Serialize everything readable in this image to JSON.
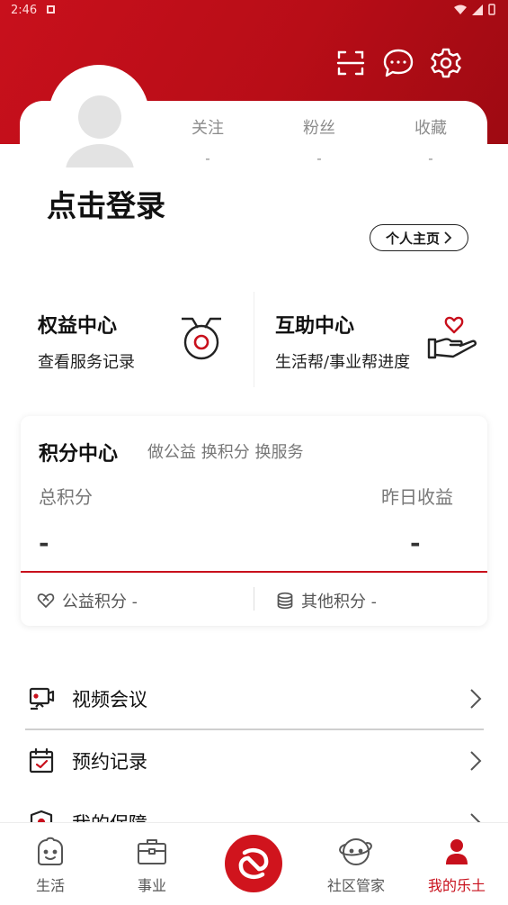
{
  "status_bar": {
    "time": "2:46"
  },
  "profile": {
    "login_text": "点击登录",
    "homepage_button": "个人主页",
    "stats": [
      {
        "label": "关注",
        "value": "-"
      },
      {
        "label": "粉丝",
        "value": "-"
      },
      {
        "label": "收藏",
        "value": "-"
      }
    ]
  },
  "features": [
    {
      "title": "权益中心",
      "subtitle": "查看服务记录",
      "icon": "medal-icon"
    },
    {
      "title": "互助中心",
      "subtitle": "生活帮/事业帮进度",
      "icon": "heart-hand-icon"
    }
  ],
  "points": {
    "title": "积分中心",
    "subtitle": "做公益 换积分 换服务",
    "total_label": "总积分",
    "total_value": "-",
    "yesterday_label": "昨日收益",
    "yesterday_value": "-",
    "charity_label": "公益积分 -",
    "other_label": "其他积分 -"
  },
  "menu": [
    {
      "label": "视频会议",
      "icon": "video-meeting-icon"
    },
    {
      "label": "预约记录",
      "icon": "calendar-check-icon"
    },
    {
      "label": "我的保障",
      "icon": "shield-icon"
    }
  ],
  "tabs": [
    {
      "label": "生活",
      "icon": "smile-face-icon"
    },
    {
      "label": "事业",
      "icon": "briefcase-icon"
    },
    {
      "label": "",
      "icon": "app-logo-icon"
    },
    {
      "label": "社区管家",
      "icon": "planet-face-icon"
    },
    {
      "label": "我的乐土",
      "icon": "person-icon"
    }
  ],
  "colors": {
    "brand_red": "#c8101c",
    "active_tab": "#c8101c"
  }
}
